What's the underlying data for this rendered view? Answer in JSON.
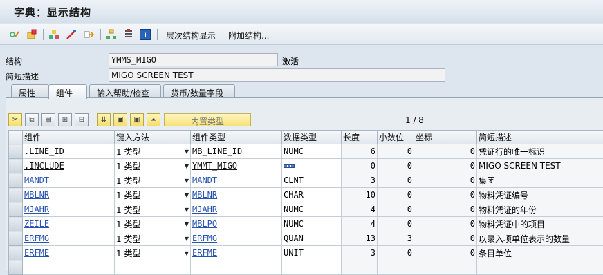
{
  "window": {
    "title": "字典：显示结构"
  },
  "toolbar": {
    "hierarchy_label": "层次结构显示",
    "append_label": "附加结构..."
  },
  "fields": {
    "structure_label": "结构",
    "structure_value": "YMMS_MIGO",
    "structure_status": "激活",
    "desc_label": "简短描述",
    "desc_value": "MIGO SCREEN TEST"
  },
  "tabs": [
    "属性",
    "组件",
    "输入帮助/检查",
    "货币/数量字段"
  ],
  "grid_toolbar": {
    "type_button": "内置类型",
    "pager": "1 / 8"
  },
  "columns": [
    "组件",
    "键入方法",
    "组件类型",
    "数据类型",
    "长度",
    "小数位",
    "坐标",
    "简短描述"
  ],
  "rows": [
    {
      "component": ".LINE_ID",
      "method": "1 类型",
      "comp_type": "MB_LINE_ID",
      "data_type": "NUMC",
      "length": "6",
      "decimals": "0",
      "coord": "0",
      "desc": "凭证行的唯一标识"
    },
    {
      "component": ".INCLUDE",
      "method": "1 类型",
      "comp_type": "YMMT_MIGO",
      "data_type": "",
      "length": "0",
      "decimals": "0",
      "coord": "0",
      "desc": "MIGO SCREEN TEST"
    },
    {
      "component": "MANDT",
      "method": "1 类型",
      "comp_type": "MANDT",
      "data_type": "CLNT",
      "length": "3",
      "decimals": "0",
      "coord": "0",
      "desc": "集团"
    },
    {
      "component": "MBLNR",
      "method": "1 类型",
      "comp_type": "MBLNR",
      "data_type": "CHAR",
      "length": "10",
      "decimals": "0",
      "coord": "0",
      "desc": "物料凭证编号"
    },
    {
      "component": "MJAHR",
      "method": "1 类型",
      "comp_type": "MJAHR",
      "data_type": "NUMC",
      "length": "4",
      "decimals": "0",
      "coord": "0",
      "desc": "物料凭证的年份"
    },
    {
      "component": "ZEILE",
      "method": "1 类型",
      "comp_type": "MBLPO",
      "data_type": "NUMC",
      "length": "4",
      "decimals": "0",
      "coord": "0",
      "desc": "物料凭证中的项目"
    },
    {
      "component": "ERFMG",
      "method": "1 类型",
      "comp_type": "ERFMG",
      "data_type": "QUAN",
      "length": "13",
      "decimals": "3",
      "coord": "0",
      "desc": "以录入项单位表示的数量"
    },
    {
      "component": "ERFME",
      "method": "1 类型",
      "comp_type": "ERFME",
      "data_type": "UNIT",
      "length": "3",
      "decimals": "0",
      "coord": "0",
      "desc": "条目单位"
    }
  ]
}
